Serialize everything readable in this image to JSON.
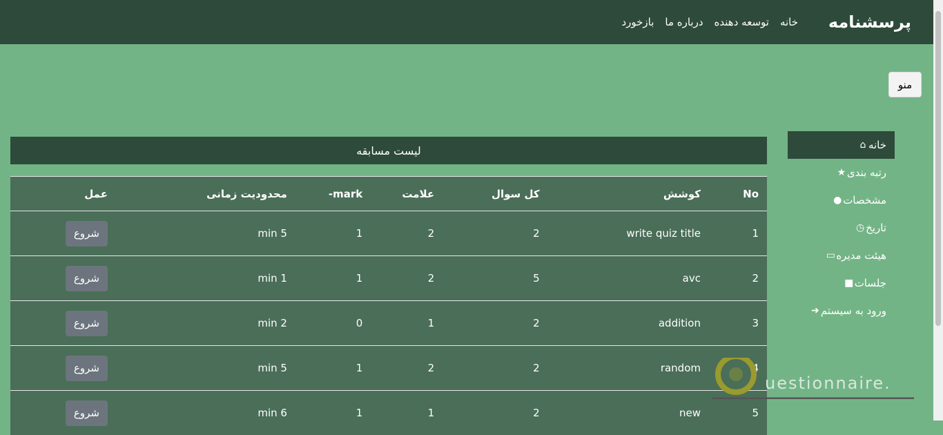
{
  "navbar": {
    "brand": "پرسشنامه",
    "links": [
      "خانه",
      "توسعه دهنده",
      "درباره ما",
      "بازخورد"
    ]
  },
  "menu_button": "منو",
  "sidebar": {
    "items": [
      {
        "label": "خانه",
        "icon": "home-icon",
        "active": true
      },
      {
        "label": "رتبه بندی",
        "icon": "star-icon"
      },
      {
        "label": "مشخصات",
        "icon": "user-icon"
      },
      {
        "label": "تاریخ",
        "icon": "history-icon"
      },
      {
        "label": "هیئت مدیره",
        "icon": "inbox-icon"
      },
      {
        "label": "جلسات",
        "icon": "video-icon"
      },
      {
        "label": "ورود به سیستم",
        "icon": "sign-in-icon"
      }
    ]
  },
  "panel": {
    "title": "لیست مسابقه"
  },
  "table": {
    "headers": {
      "no": "No",
      "title": "کوشش",
      "total": "کل سوال",
      "mark": "علامت",
      "neg_mark": "-mark",
      "time": "محدودیت زمانی",
      "action": "عمل"
    },
    "rows": [
      {
        "no": "1",
        "title": "write quiz title",
        "total": "2",
        "mark": "2",
        "neg": "1",
        "time": "min 5",
        "action": "شروع"
      },
      {
        "no": "2",
        "title": "avc",
        "total": "5",
        "mark": "2",
        "neg": "1",
        "time": "min 1",
        "action": "شروع"
      },
      {
        "no": "3",
        "title": "addition",
        "total": "2",
        "mark": "1",
        "neg": "0",
        "time": "min 2",
        "action": "شروع"
      },
      {
        "no": "4",
        "title": "random",
        "total": "2",
        "mark": "2",
        "neg": "1",
        "time": "min 5",
        "action": "شروع"
      },
      {
        "no": "5",
        "title": "new",
        "total": "2",
        "mark": "1",
        "neg": "1",
        "time": "min 6",
        "action": "شروع"
      }
    ]
  },
  "logo_text": "uestionnaire.",
  "colors": {
    "bg": "#73b486",
    "dark": "#2e4a3a",
    "table": "#4a6e58",
    "button": "#6c757d"
  }
}
